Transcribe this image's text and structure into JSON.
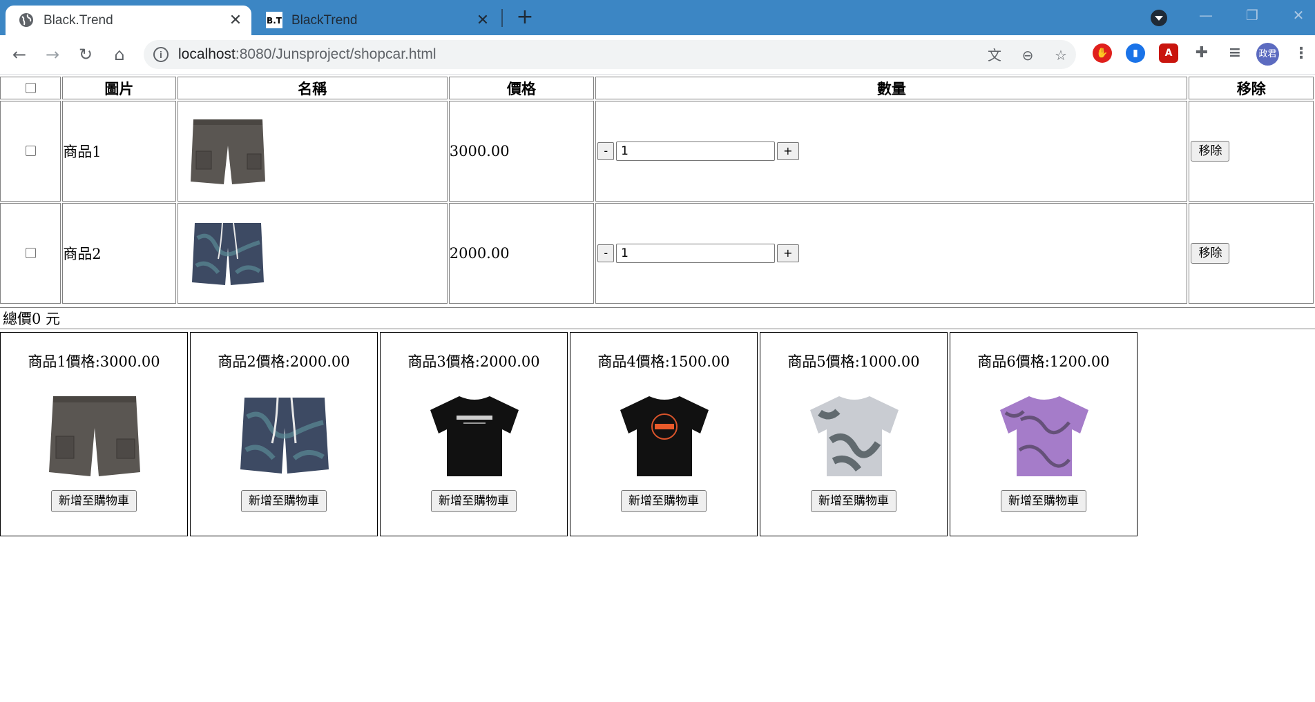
{
  "browser": {
    "tabs": [
      {
        "title": "Black.Trend",
        "favicon": "globe-icon",
        "active": true
      },
      {
        "title": "BlackTrend",
        "favicon": "B.T",
        "active": false
      }
    ],
    "url_host": "localhost",
    "url_path": ":8080/Junsproject/shopcar.html",
    "profile_initials": "政君",
    "icons": [
      "back-icon",
      "forward-icon",
      "reload-icon",
      "home-icon",
      "site-info-icon",
      "translate-icon",
      "zoom-out-icon",
      "bookmark-star-icon",
      "adblock-icon",
      "bookmark-ext-icon",
      "acrobat-icon",
      "extensions-puzzle-icon",
      "reading-list-icon",
      "menu-icon"
    ]
  },
  "cart": {
    "headers": {
      "select": "",
      "image": "圖片",
      "name": "名稱",
      "price": "價格",
      "quantity": "數量",
      "remove": "移除"
    },
    "rows": [
      {
        "name": "商品1",
        "price": "3000.00",
        "qty": "1",
        "minus": "-",
        "plus": "+",
        "remove": "移除",
        "image": "gray-cargo-shorts"
      },
      {
        "name": "商品2",
        "price": "2000.00",
        "qty": "1",
        "minus": "-",
        "plus": "+",
        "remove": "移除",
        "image": "tie-dye-shorts"
      }
    ],
    "total_label": "總價0 元"
  },
  "products": [
    {
      "title": "商品1價格:3000.00",
      "button": "新增至購物車",
      "image": "gray-cargo-shorts"
    },
    {
      "title": "商品2價格:2000.00",
      "button": "新增至購物車",
      "image": "tie-dye-shorts"
    },
    {
      "title": "商品3價格:2000.00",
      "button": "新增至購物車",
      "image": "black-tshirt-text"
    },
    {
      "title": "商品4價格:1500.00",
      "button": "新增至購物車",
      "image": "black-tshirt-orange-logo"
    },
    {
      "title": "商品5價格:1000.00",
      "button": "新增至購物車",
      "image": "gray-tie-dye-tshirt"
    },
    {
      "title": "商品6價格:1200.00",
      "button": "新增至購物車",
      "image": "purple-tie-dye-tshirt"
    }
  ],
  "colors": {
    "tab_strip": "#3c86c4",
    "page_bg": "#ffffff",
    "button_bg": "#efefef"
  }
}
